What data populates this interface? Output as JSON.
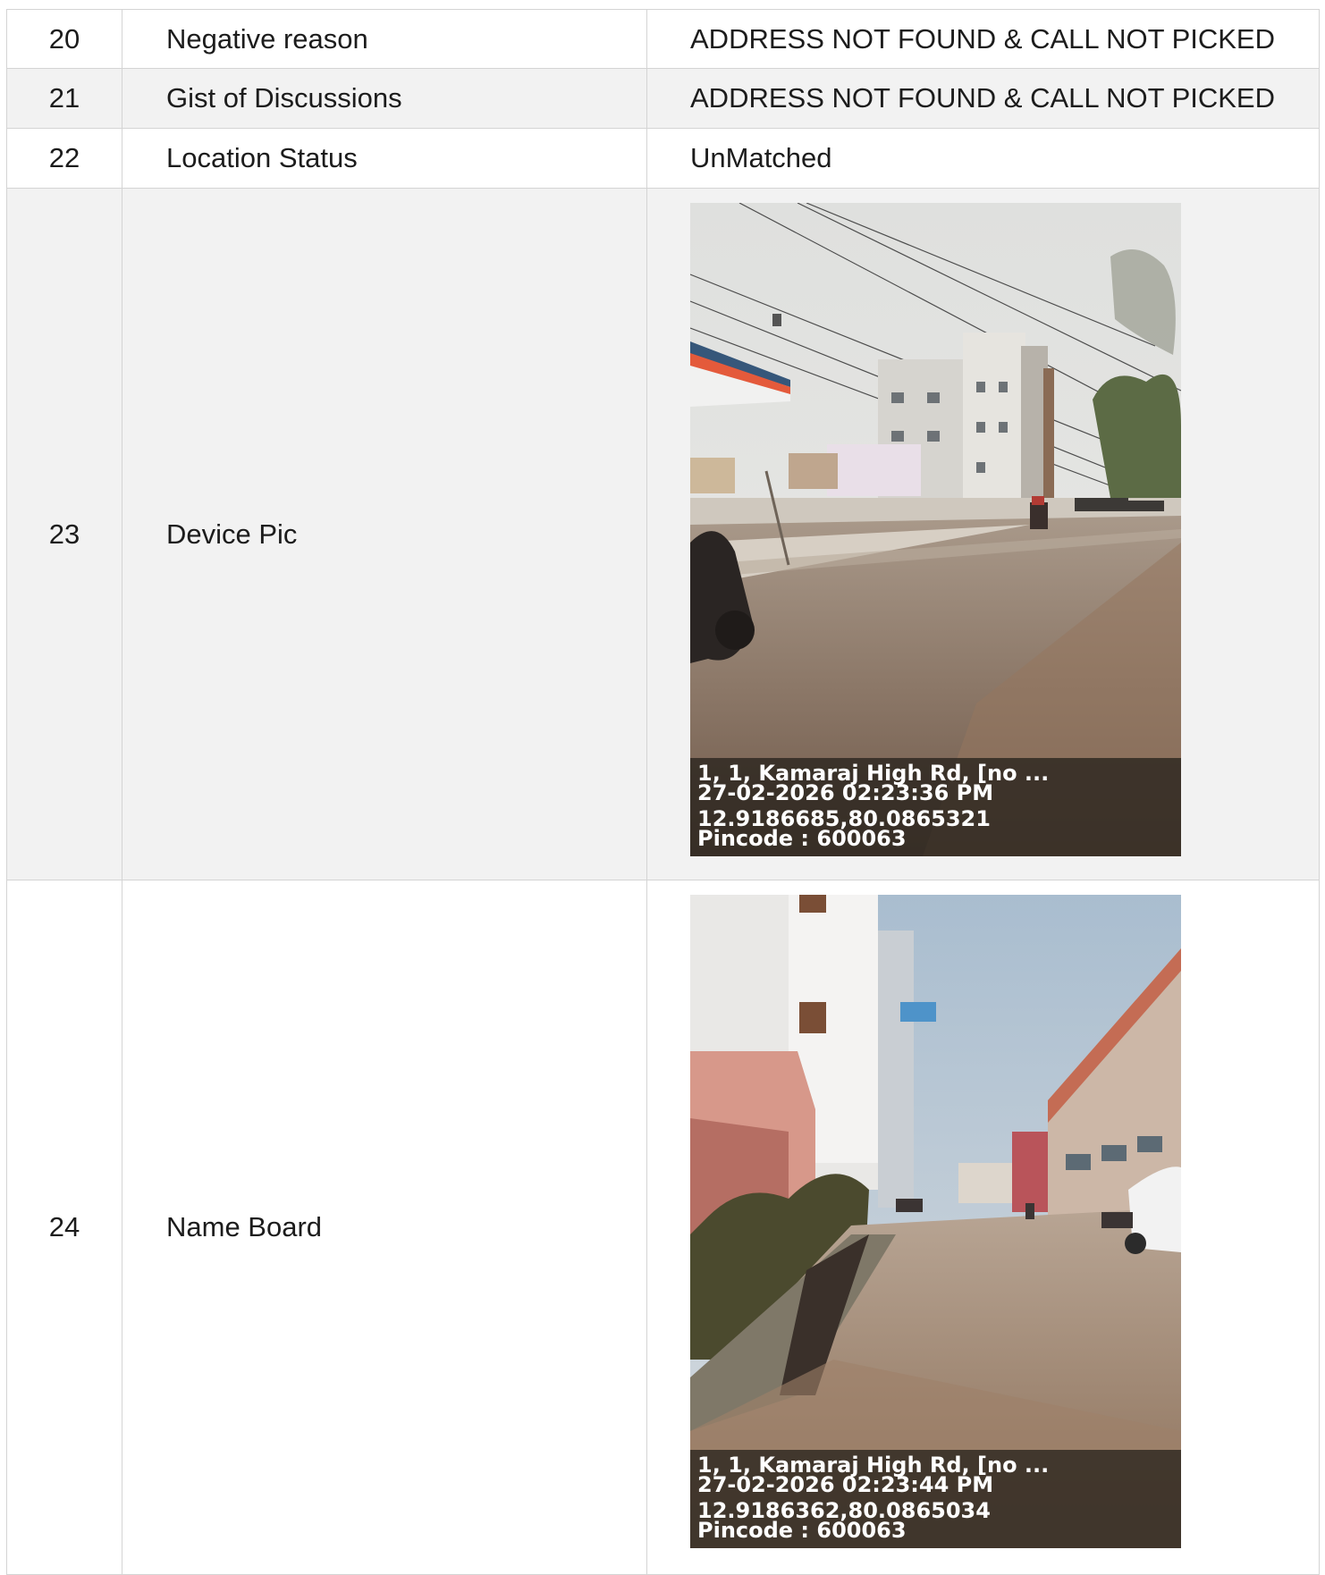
{
  "rows": [
    {
      "num": "20",
      "label": "Negative reason",
      "value": "ADDRESS NOT FOUND & CALL NOT PICKED"
    },
    {
      "num": "21",
      "label": "Gist of Discussions",
      "value": "ADDRESS NOT FOUND & CALL NOT PICKED"
    },
    {
      "num": "22",
      "label": "Location Status",
      "value": "UnMatched"
    },
    {
      "num": "23",
      "label": "Device Pic",
      "photo": {
        "address": "1, 1, Kamaraj High Rd, [no ...",
        "datetime": "27-02-2026 02:23:36 PM",
        "coords": "12.9186685,80.0865321",
        "pincode": "Pincode : 600063"
      }
    },
    {
      "num": "24",
      "label": "Name Board",
      "photo": {
        "address": "1, 1, Kamaraj High Rd, [no ...",
        "datetime": "27-02-2026 02:23:44 PM",
        "coords": "12.9186362,80.0865034",
        "pincode": "Pincode : 600063"
      }
    }
  ]
}
